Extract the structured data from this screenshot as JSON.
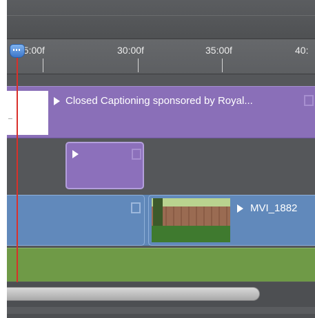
{
  "ruler": {
    "ticks": [
      {
        "label": "25:00f"
      },
      {
        "label": "30:00f"
      },
      {
        "label": "35:00f"
      },
      {
        "label": "40:"
      }
    ]
  },
  "caption_clip": {
    "label": "Closed Captioning sponsored by Royal..."
  },
  "video_clip": {
    "label": "MVI_1882"
  },
  "colors": {
    "caption_clip": "#8a6fb8",
    "video_clip": "#6189bb",
    "audio_track": "#6f9a47",
    "playhead": "#d9302a"
  }
}
